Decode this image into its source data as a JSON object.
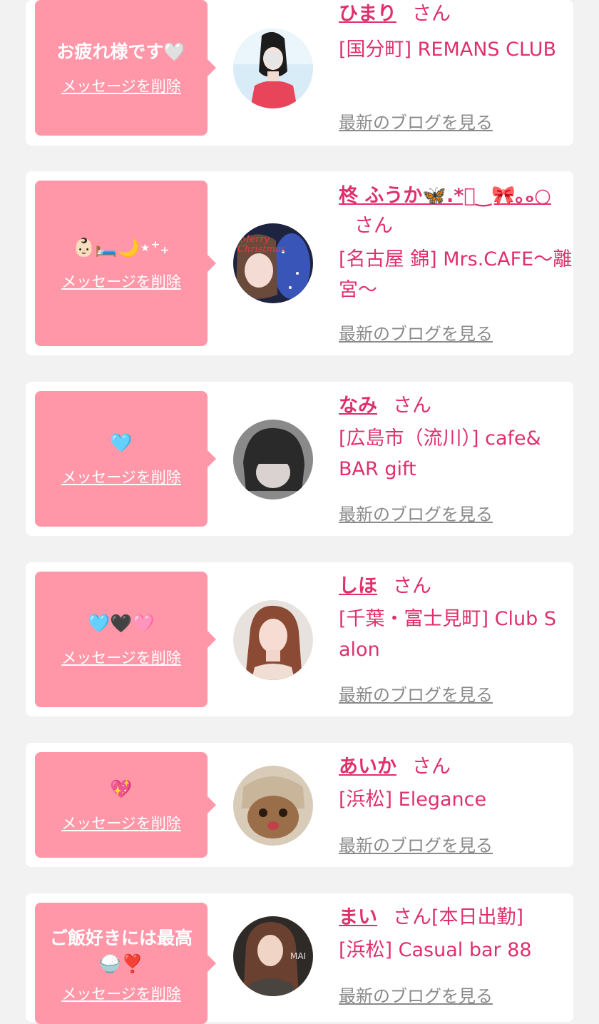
{
  "colors": {
    "background": "#f2f2f2",
    "card": "#ffffff",
    "bubble": "#ff97a8",
    "accent": "#e0306a",
    "link_gray": "#8a8a8a"
  },
  "entries": [
    {
      "message": "お疲れ様です🤍",
      "delete_label": "メッセージを削除",
      "name": "ひまり",
      "honorific": "さん",
      "status": "",
      "shop": "[国分町] REMANS CLUB",
      "blog_label": "最新のブログを見る",
      "avatar_icon": "woman-in-red-dress-avatar"
    },
    {
      "message": "👶🏻🛏️🌙⋆⁺₊",
      "delete_label": "メッセージを削除",
      "name": "柊 ふうか🦋.*ﾟ‿🎀｡ₒ○",
      "honorific": "さん",
      "status": "",
      "shop": "[名古屋 錦] Mrs.CAFE〜離宮〜",
      "blog_label": "最新のブログを見る",
      "avatar_icon": "christmas-selfie-avatar"
    },
    {
      "message": "🩵",
      "delete_label": "メッセージを削除",
      "name": "なみ",
      "honorific": "さん",
      "status": "",
      "shop": "[広島市（流川）] cafe&BAR gift",
      "blog_label": "最新のブログを見る",
      "avatar_icon": "dark-hair-avatar"
    },
    {
      "message": "🩵🖤🩷",
      "delete_label": "メッセージを削除",
      "name": "しほ",
      "honorific": "さん",
      "status": "",
      "shop": "[千葉・富士見町] Club Salon",
      "blog_label": "最新のブログを見る",
      "avatar_icon": "portrait-avatar"
    },
    {
      "message": "💖",
      "delete_label": "メッセージを削除",
      "name": "あいか",
      "honorific": "さん",
      "status": "",
      "shop": "[浜松] Elegance",
      "blog_label": "最新のブログを見る",
      "avatar_icon": "cat-avatar"
    },
    {
      "message": "ご飯好きには最高🍚❣️",
      "delete_label": "メッセージを削除",
      "name": "まい",
      "honorific": "さん",
      "status": "[本日出勤]",
      "shop": "[浜松] Casual bar 88",
      "blog_label": "最新のブログを見る",
      "avatar_icon": "mai-portrait-avatar"
    }
  ]
}
